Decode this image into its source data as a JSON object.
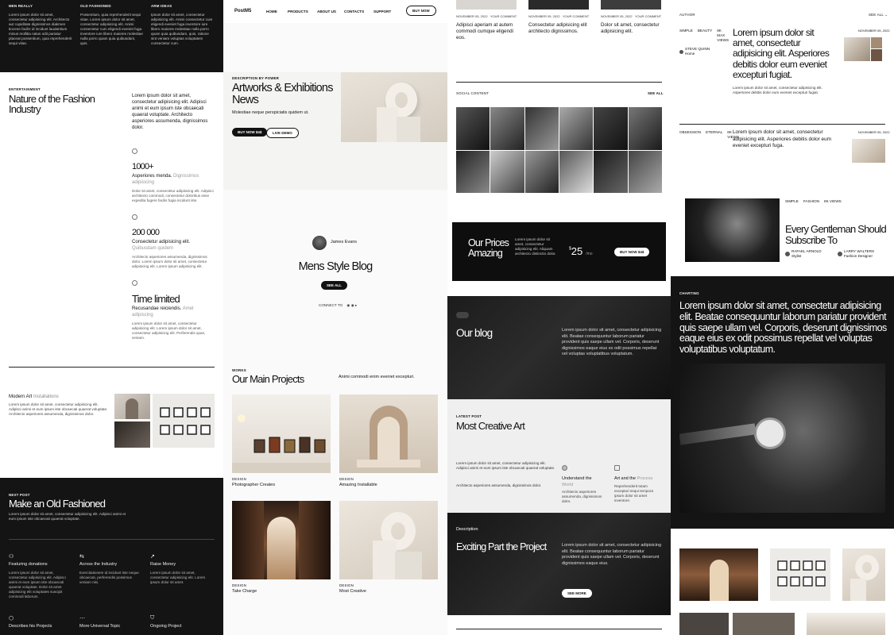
{
  "c1": {
    "top_cols": [
      {
        "label": "MEN REALLY",
        "text": "Lorem ipsum dolor sit amet, consectetur adipisicing elit. Architecto aut cupiditate dignissimos diakmen tiocene facilis id incidunt laudantium minus mollitia natus odit pariatur placeat possentium, quia reprehenderit sequi vitae."
      },
      {
        "label": "OLD FASHIONED",
        "text": "Possentium, quia reprehenderit sequi vitae. Lorem ipsum dolor sit amet, consectetur adipisicing elit. Animi consectetur cum eligendi eveniet fuga inventore iure libero maiores molestiae nulla porro quam quia quibusdam, quis."
      },
      {
        "label": "ARM IDEAS",
        "text": "Ipsum dolor sit amet, consectetur adipisicing elit. Animi consectetur cum eligendi eveniet fuga inventore iure libero maiores molestiae nulla porro quam quia quibusdam, quis, ratione sint veniam voluptas voluptatem consectetur cum."
      }
    ],
    "ent_label": "ENTERTAINMENT",
    "ent_title": "Nature of the Fashion Industry",
    "ent_text": "Lorem ipsum dolor sit amet, consectetur adipisicing elit. Adipisci animi et eum ipsum iste obcaecati quaerat voluptate. Architecto asperiores assumenda, dignissimos dolor.",
    "stats": [
      {
        "value": "1000+",
        "label": "Asperiores menda.",
        "muted": "Dignissimos adipisicing",
        "text": "Dolor sit amet, consectetur adipisicing elit. Adipisci architecto commodi, consectetur doloribus esse expedita fugere facilis fugia incidunt iste."
      },
      {
        "value": "200 000",
        "label": "Consectetur adipisicing elit.",
        "muted": "Quibusdam quidem",
        "text": "Architecto asperiores assumenda, dignissimos dolor. Lorem ipsum dolor sit amet, consectetur adipisicing elit. Lorem ipsum adipisicing elit."
      },
      {
        "value": "Time limited",
        "label": "Recusandae reiciendis.",
        "muted": "Amet adipiscing",
        "text": "Lorem ipsum dolor sit amet, consectetur adipisicing elit. Lorem ipsum dolor sit amet, consectetur adipisicing elit. Perferendis quas, veniam."
      }
    ],
    "modern_title": "Modern Art",
    "modern_muted": "Installations",
    "modern_text": "Lorem ipsum dolor sit amet, consectetur adipisicing elit. Adipisci animi et eum ipsum iste obcaecati quaerat voluptate. Architecto asperiores assumenda, dignissimos dolor.",
    "next_label": "NEXT POST",
    "next_title": "Make an Old Fashioned",
    "next_text": "Lorem ipsum dolor sit amet, consectetur adipisicing elit. Adipisci animi et eum ipsum iste obcaecati quaerat voluptate.",
    "features": [
      {
        "title": "Featuring donations",
        "text": "Lorem ipsum dolor sit amet, consectetur adipisicing elit. Adipisci animi et eum ipsum iste obcaecati quaerat voluptate. Dolor sit amet adipisicing elit voluptates suscipit commodi laborum."
      },
      {
        "title": "Across the Industry",
        "text": "Exercitationem id incidunt iste neque obcaecati, perferendis possimus veniam nisi."
      },
      {
        "title": "Raise Money",
        "text": "Lorem ipsum dolor sit amet, consectetur adipisicing elit. Lorem ipsum dolor sit amet."
      }
    ],
    "bottom": [
      "Describes his Projects",
      "More Universal Topic",
      "Ongoing Project"
    ]
  },
  "c2": {
    "brand": "PostM5",
    "nav": [
      "HOME",
      "PRODUCTS",
      "ABOUT US",
      "CONTACTS",
      "SUPPORT"
    ],
    "buy": "BUY NOW",
    "hero_label": "DESCRIPTION BY POWER",
    "hero_title": "Artworks & Exhibitions News",
    "hero_text": "Molestiae neque perspiciatis quidem ut.",
    "hero_buy": "BUY NOW $4$",
    "hero_live": "LIVE DEMO",
    "author": "James Evans",
    "blog_title": "Mens Style Blog",
    "see_all": "SEE ALL",
    "connect": "CONNECT TO",
    "works_label": "WORKS",
    "works_title": "Our Main Projects",
    "works_text": "Animi commodi enim eveniet excepturi.",
    "projects": [
      {
        "cat": "DESIGN",
        "title": "Photographer Creates"
      },
      {
        "cat": "DESIGN",
        "title": "Amazing Installable"
      },
      {
        "cat": "DESIGN",
        "title": "Take Charge"
      },
      {
        "cat": "DESIGN",
        "title": "Most Creative"
      }
    ]
  },
  "c3": {
    "news": [
      {
        "date": "NOVEMBER 05, 2022",
        "by": "YOUR COMMENT",
        "text": "Adipisci aperiam at autem commodi cumque eligendi eos."
      },
      {
        "date": "NOVEMBER 05, 2022",
        "by": "YOUR COMMENT",
        "text": "Consectetur adipisicing elit architecto dignissimos."
      },
      {
        "date": "NOVEMBER 05, 2022",
        "by": "YOUR COMMENT",
        "text": "Dolor sit amet, consectetur adipisicing elit."
      }
    ],
    "social_label": "SOCIAL CONTENT",
    "social_see": "SEE ALL",
    "price_title": "Our Prices Amazing",
    "price_text": "Lorem ipsum dolor sit amet, consectetur adipisicing elit. Aliquam architecto distinctio dolor.",
    "price_value": "25",
    "price_currency": "$",
    "price_unit": "/mo",
    "price_btn": "BUY NOW $4$",
    "blog_title": "Our blog",
    "blog_text": "Lorem ipsum dolor sit amet, consectetur adipisicing elit. Beatae consequuntur laborum pariatur provident quis saepe ullam vel. Corporis, deserunt dignissimos eaque eius ex odit possimus repellat vel voluptas voluptatibus voluptatum.",
    "latest_label": "LATEST POST",
    "latest_title": "Most Creative Art",
    "latest_text": "Lorem ipsum dolor sit amet, consectetur adipisicing elit. Adipisci animi et eum ipsum iste obcaecati quaerat voluptate.",
    "latest_text2": "Architecto asperiores assumenda, dignissimos dolor.",
    "und_title": "Understand the",
    "und_muted": "World",
    "und_text": "Architecto asperiores assumenda, dignissimos dolor.",
    "art_title": "Art and the",
    "art_muted": "Process",
    "art_text": "Reprehenderit totam excepturi sequi tempora ipsum dolor sit amet inventore.",
    "desc_label": "Description",
    "desc_title": "Exciting Part the Project",
    "desc_text": "Lorem ipsum dolor sit amet, consectetur adipisicing elit. Beatae consequuntur laborum pariatur provident quis saepe ullam vel. Corporis, deserunt dignissimos eaque eius.",
    "desc_btn": "SEE MORE"
  },
  "c4": {
    "author_label": "AUTHOR",
    "see_all": "SEE ALL",
    "post1_meta": [
      "SIMPLE",
      "BEAUTY",
      "8K MAX VIEWS"
    ],
    "post1_name": "STEVE QUINN",
    "post1_role": "Home",
    "post1_title": "Lorem ipsum dolor sit amet, consectetur adipisicing elit. Asperiores debitis dolor eum eveniet excepturi fugiat.",
    "post1_date": "NOVEMBER 05, 2022",
    "post1_text": "Lorem ipsum dolor sit amet, consectetur adipisicing elit. Asperiores debitis dolor eum eveniet excepturi fugiat.",
    "post2_meta": [
      "OBSESSION",
      "ETERNAL",
      "8K VIEWS"
    ],
    "post2_text": "Lorem ipsum dolor sit amet, consectetur adipisicing elit. Asperiores debitis dolor eum eveniet excepturi fuga.",
    "post2_date": "NOVEMBER 05, 2022",
    "gent_meta": [
      "SIMPLE",
      "FASHION",
      "8K VIEWS"
    ],
    "gent_title": "Every Gentleman Should Subscribe To",
    "gent_p1_name": "RAFAEL ARNOLD",
    "gent_p1_role": "Stylist",
    "gent_p2_name": "LARRY WALTERS",
    "gent_p2_role": "Fashion Designer",
    "chart_label": "CHARTING",
    "chart_title": "Lorem ipsum dolor sit amet, consectetur adipisicing elit. Beatae consequuntur laborum pariatur provident quis saepe ullam vel. Corporis, deserunt dignissimos eaque eius ex odit possimus repellat vel voluptas voluptatibus voluptatum."
  }
}
